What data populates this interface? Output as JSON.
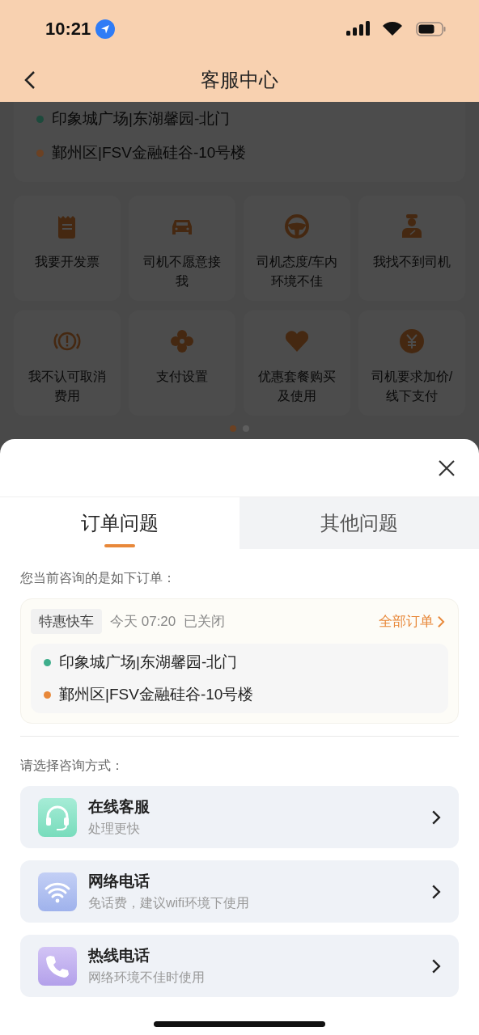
{
  "status_bar": {
    "time": "10:21"
  },
  "nav": {
    "title": "客服中心"
  },
  "background_order": {
    "stops": [
      {
        "text": "印象城广场|东湖馨园-北门",
        "color": "#1d4a3c"
      },
      {
        "text": "鄞州区|FSV金融硅谷-10号楼",
        "color": "#6b4123"
      }
    ]
  },
  "issues": [
    {
      "label": "我要开发票",
      "kind": "receipt"
    },
    {
      "label": "司机不愿意接我",
      "kind": "car"
    },
    {
      "label": "司机态度/车内环境不佳",
      "kind": "wheel"
    },
    {
      "label": "我找不到司机",
      "kind": "driver"
    },
    {
      "label": "我不认可取消费用",
      "kind": "alert"
    },
    {
      "label": "支付设置",
      "kind": "flower"
    },
    {
      "label": "优惠套餐购买及使用",
      "kind": "heart"
    },
    {
      "label": "司机要求加价/线下支付",
      "kind": "yen"
    }
  ],
  "pager": [
    {
      "selected": true
    },
    {
      "selected": false
    }
  ],
  "sheet": {
    "tabs": [
      {
        "label": "订单问题",
        "selected": true
      },
      {
        "label": "其他问题",
        "selected": false
      }
    ],
    "order_prompt": "您当前咨询的是如下订单：",
    "order": {
      "tag": "特惠快车",
      "time": "今天 07:20",
      "status": "已关闭",
      "link": "全部订单",
      "stops": [
        {
          "text": "印象城广场|东湖馨园-北门",
          "color": "#3fae8c"
        },
        {
          "text": "鄞州区|FSV金融硅谷-10号楼",
          "color": "#e8883a"
        }
      ]
    },
    "method_prompt": "请选择咨询方式：",
    "methods": [
      {
        "title": "在线客服",
        "subtitle": "处理更快",
        "kind": "headset"
      },
      {
        "title": "网络电话",
        "subtitle": "免话费，建议wifi环境下使用",
        "kind": "wifi"
      },
      {
        "title": "热线电话",
        "subtitle": "网络环境不佳时使用",
        "kind": "phone"
      }
    ]
  }
}
